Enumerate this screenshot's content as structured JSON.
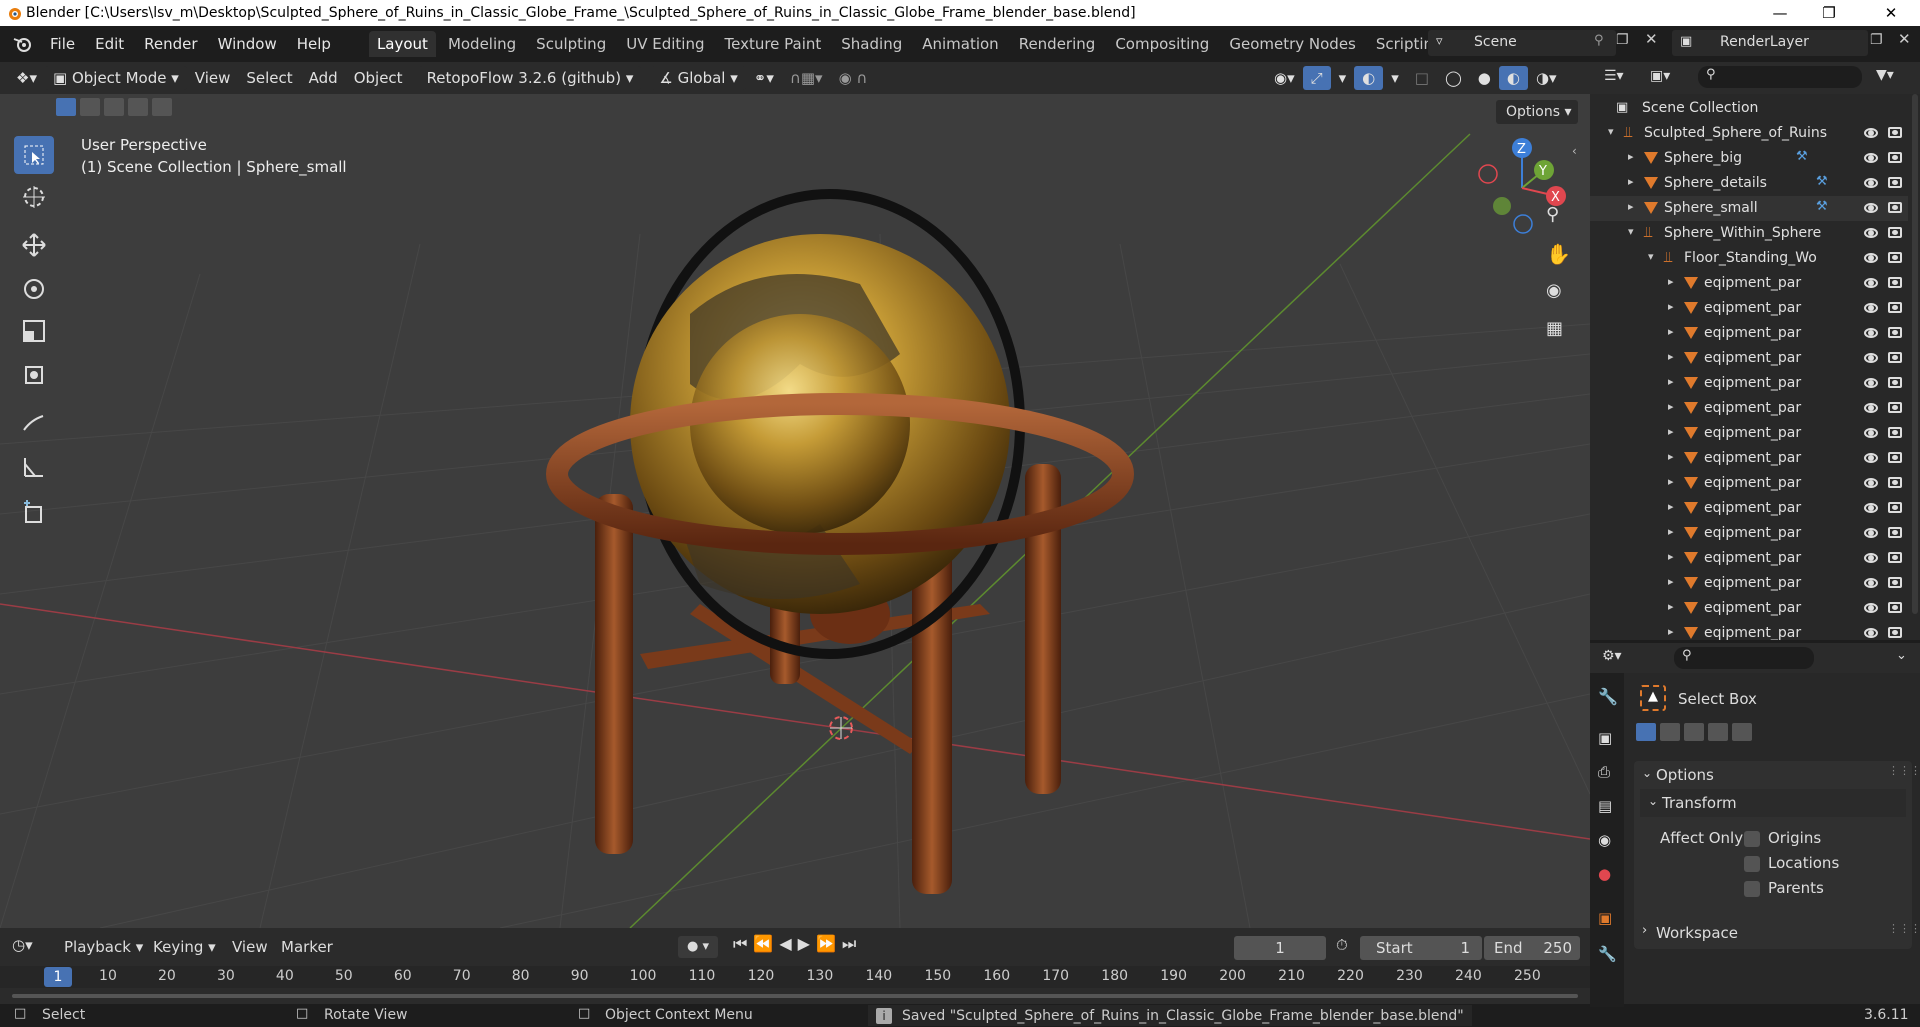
{
  "window": {
    "title": "Blender [C:\\Users\\lsv_m\\Desktop\\Sculpted_Sphere_of_Ruins_in_Classic_Globe_Frame_\\Sculpted_Sphere_of_Ruins_in_Classic_Globe_Frame_blender_base.blend]"
  },
  "menu": [
    "File",
    "Edit",
    "Render",
    "Window",
    "Help"
  ],
  "workspaces": [
    "Layout",
    "Modeling",
    "Sculpting",
    "UV Editing",
    "Texture Paint",
    "Shading",
    "Animation",
    "Rendering",
    "Compositing",
    "Geometry Nodes",
    "Scripting"
  ],
  "active_workspace": "Layout",
  "scene": "Scene",
  "render_layer": "RenderLayer",
  "viewport_header": {
    "mode": "Object Mode",
    "view": "View",
    "select": "Select",
    "add": "Add",
    "object": "Object",
    "addon": "RetopoFlow 3.2.6 (github)",
    "orientation": "Global",
    "options": "Options"
  },
  "viewport": {
    "line1": "User Perspective",
    "line2": "(1) Scene Collection | Sphere_small"
  },
  "gizmo": {
    "x": "X",
    "y": "Y",
    "z": "Z"
  },
  "outliner": {
    "root": "Scene Collection",
    "rows": [
      {
        "label": "Sculpted_Sphere_of_Ruins",
        "indent": 1
      },
      {
        "label": "Sphere_big",
        "indent": 2
      },
      {
        "label": "Sphere_details",
        "indent": 2
      },
      {
        "label": "Sphere_small",
        "indent": 2
      },
      {
        "label": "Sphere_Within_Sphere",
        "indent": 2
      },
      {
        "label": "Floor_Standing_Wo",
        "indent": 3
      },
      {
        "label": "eqipment_par",
        "indent": 4
      },
      {
        "label": "eqipment_par",
        "indent": 4
      },
      {
        "label": "eqipment_par",
        "indent": 4
      },
      {
        "label": "eqipment_par",
        "indent": 4
      },
      {
        "label": "eqipment_par",
        "indent": 4
      },
      {
        "label": "eqipment_par",
        "indent": 4
      },
      {
        "label": "eqipment_par",
        "indent": 4
      },
      {
        "label": "eqipment_par",
        "indent": 4
      },
      {
        "label": "eqipment_par",
        "indent": 4
      },
      {
        "label": "eqipment_par",
        "indent": 4
      },
      {
        "label": "eqipment_par",
        "indent": 4
      },
      {
        "label": "eqipment_par",
        "indent": 4
      },
      {
        "label": "eqipment_par",
        "indent": 4
      },
      {
        "label": "eqipment_par",
        "indent": 4
      },
      {
        "label": "eqipment_par",
        "indent": 4
      }
    ]
  },
  "properties": {
    "tool_name": "Select Box",
    "options": "Options",
    "transform": "Transform",
    "affect_only": "Affect Only",
    "origins": "Origins",
    "locations": "Locations",
    "parents": "Parents",
    "workspace": "Workspace"
  },
  "timeline": {
    "playback": "Playback",
    "keying": "Keying",
    "view": "View",
    "marker": "Marker",
    "current_frame": "1",
    "start_label": "Start",
    "start": "1",
    "end_label": "End",
    "end": "250",
    "ruler": [
      "1",
      "10",
      "20",
      "30",
      "40",
      "50",
      "60",
      "70",
      "80",
      "90",
      "100",
      "110",
      "120",
      "130",
      "140",
      "150",
      "160",
      "170",
      "180",
      "190",
      "200",
      "210",
      "220",
      "230",
      "240",
      "250"
    ]
  },
  "status": {
    "select": "Select",
    "rotate": "Rotate View",
    "context": "Object Context Menu",
    "message": "Saved \"Sculpted_Sphere_of_Ruins_in_Classic_Globe_Frame_blender_base.blend\"",
    "version": "3.6.11"
  },
  "colors": {
    "accent": "#4772b3",
    "object_orange": "#e07a2c",
    "x_axis": "#e0474f",
    "y_axis": "#6ea436",
    "z_axis": "#3d7fd8"
  }
}
